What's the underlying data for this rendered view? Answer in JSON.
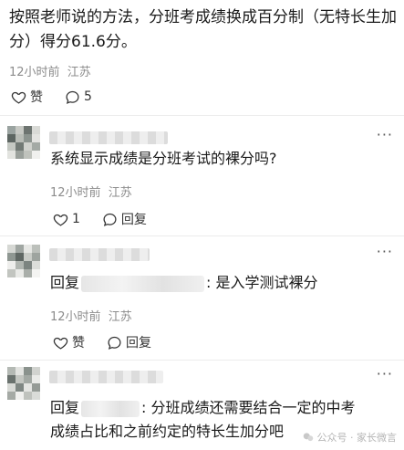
{
  "post": {
    "text": "按照老师说的方法，分班考成绩换成百分制（无特长生加分）得分61.6分。",
    "time": "12小时前",
    "location": "江苏",
    "like_label": "赞",
    "comment_count": "5"
  },
  "comments": [
    {
      "text": "系统显示成绩是分班考试的裸分吗?",
      "time": "12小时前",
      "location": "江苏",
      "like_count": "1",
      "reply_label": "回复"
    },
    {
      "reply_prefix": "回复",
      "text": ": 是入学测试裸分",
      "time": "12小时前",
      "location": "江苏",
      "like_label": "赞",
      "reply_label": "回复"
    },
    {
      "reply_prefix": "回复",
      "text_line1": ": 分班成绩还需要结合一定的中考",
      "text_line2": "成绩占比和之前约定的特长生加分吧"
    }
  ],
  "more_label": "···",
  "watermark": "公众号 · 家长微言"
}
